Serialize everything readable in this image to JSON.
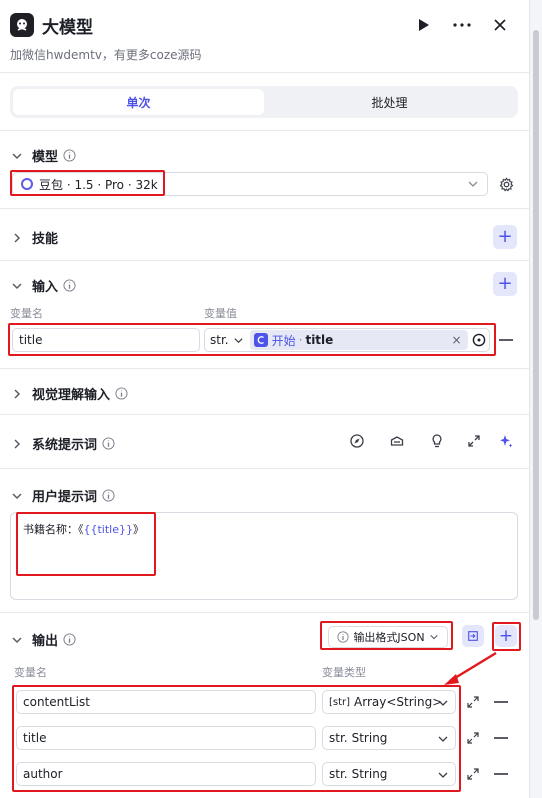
{
  "header": {
    "title": "大模型",
    "description": "加微信hwdemtv，有更多coze源码"
  },
  "tabs": [
    {
      "label": "单次",
      "active": true
    },
    {
      "label": "批处理",
      "active": false
    }
  ],
  "sections": {
    "model": {
      "title": "模型",
      "selected": "豆包 · 1.5 · Pro · 32k"
    },
    "skills": {
      "title": "技能"
    },
    "input": {
      "title": "输入",
      "col_name": "变量名",
      "col_value": "变量值",
      "row": {
        "name": "title",
        "type": "str.",
        "ref_source": "开始",
        "ref_sep": "·",
        "ref_var": "title"
      }
    },
    "visual": {
      "title": "视觉理解输入"
    },
    "system_prompt": {
      "title": "系统提示词"
    },
    "user_prompt": {
      "title": "用户提示词",
      "prefix": "书籍名称：《",
      "var": "{{title}}",
      "suffix": "》"
    },
    "output": {
      "title": "输出",
      "format_label": "输出格式JSON",
      "col_name": "变量名",
      "col_type": "变量类型",
      "rows": [
        {
          "name": "contentList",
          "type_badge": "[str]",
          "type": "Array<String>"
        },
        {
          "name": "title",
          "type_badge": "str.",
          "type": "String"
        },
        {
          "name": "author",
          "type_badge": "str.",
          "type": "String"
        }
      ]
    }
  },
  "colors": {
    "accent": "#4d53e8",
    "highlight": "#e1191f",
    "accent_bg": "#e4e6fb"
  }
}
